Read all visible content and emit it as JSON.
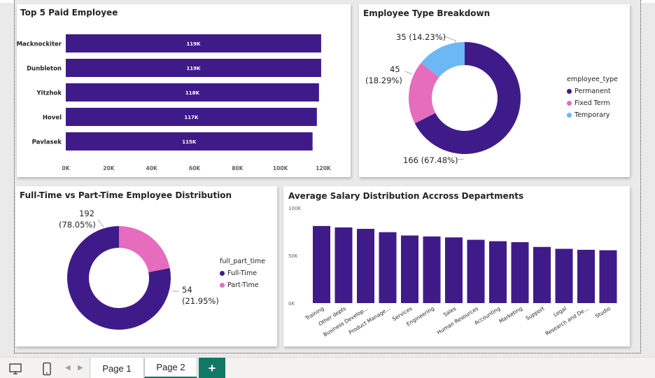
{
  "colors": {
    "purple": "#3f1b8a",
    "pink": "#e66cbd",
    "blue": "#6cb8f5",
    "tab_accent": "#117865"
  },
  "cards": {
    "top5": {
      "title": "Top 5 Paid Employee"
    },
    "emptype": {
      "title": "Employee Type Breakdown",
      "legend_title": "employee_type",
      "labels": {
        "temporary": "35 (14.23%)",
        "fixed_a": "45",
        "fixed_b": "(18.29%)",
        "permanent": "166 (67.48%)"
      }
    },
    "fullpart": {
      "title": "Full-Time vs Part-Time Employee Distribution",
      "legend_title": "full_part_time",
      "labels": {
        "full_a": "192",
        "full_b": "(78.05%)",
        "part_a": "54",
        "part_b": "(21.95%)"
      }
    },
    "salary": {
      "title": "Average Salary Distribution Accross Departments"
    }
  },
  "chart_data": [
    {
      "type": "bar",
      "orientation": "horizontal",
      "title": "Top 5 Paid Employee",
      "categories": [
        "Macknockiter",
        "Dunbleton",
        "Yitzhok",
        "Hovel",
        "Pavlasek"
      ],
      "values": [
        119000,
        119000,
        118000,
        117000,
        115000
      ],
      "data_labels": [
        "119K",
        "119K",
        "118K",
        "117K",
        "115K"
      ],
      "xlim": [
        0,
        120000
      ],
      "x_ticks": [
        "0K",
        "20K",
        "40K",
        "60K",
        "80K",
        "100K",
        "120K"
      ],
      "grid": false
    },
    {
      "type": "pie",
      "variant": "donut",
      "title": "Employee Type Breakdown",
      "categories": [
        "Permanent",
        "Fixed Term",
        "Temporary"
      ],
      "values": [
        166,
        45,
        35
      ],
      "percentages": [
        67.48,
        18.29,
        14.23
      ],
      "legend_position": "right"
    },
    {
      "type": "pie",
      "variant": "donut",
      "title": "Full-Time vs Part-Time Employee Distribution",
      "categories": [
        "Full-Time",
        "Part-Time"
      ],
      "values": [
        192,
        54
      ],
      "percentages": [
        78.05,
        21.95
      ],
      "legend_position": "right"
    },
    {
      "type": "bar",
      "orientation": "vertical",
      "title": "Average Salary Distribution Accross Departments",
      "categories": [
        "Training",
        "Other depts",
        "Business Develop...",
        "Product Manage...",
        "Services",
        "Engineering",
        "Sales",
        "Human Resources",
        "Accounting",
        "Marketing",
        "Support",
        "Legal",
        "Research and De...",
        "Studio"
      ],
      "values": [
        81000,
        79500,
        78000,
        74500,
        71000,
        70000,
        69000,
        66500,
        65000,
        64000,
        59000,
        57000,
        56000,
        55500
      ],
      "ylim": [
        0,
        100000
      ],
      "y_ticks": [
        "0K",
        "50K",
        "100K"
      ],
      "grid": false
    }
  ],
  "tabs": [
    "Page 1",
    "Page 2"
  ],
  "add_label": "+"
}
